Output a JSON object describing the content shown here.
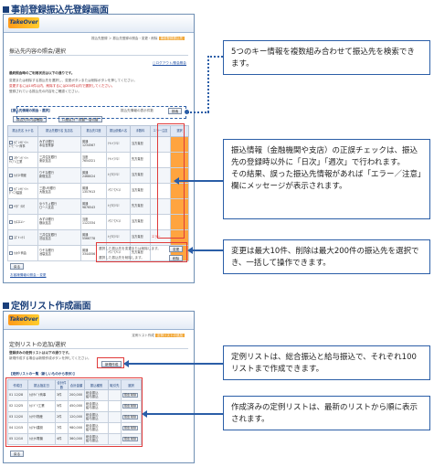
{
  "sections": {
    "registration_title": "事前登録振込先登録画面",
    "template_title": "定例リスト作成画面"
  },
  "reg_screen": {
    "logo": "TakeOver",
    "breadcrumb": "振込先登録 ＞ 振込先登録の照会・変更・削除",
    "breadcrumb_highlight": "事前登録振込先",
    "page_title": "振込先内容の照会/選択",
    "link_top": "□ログアウト/照会照会",
    "notice_heading": "最終照会時のご利用状況は以下の通りです。",
    "notice_lines": [
      "変更または削除する振込先を選択し、変更ボタンまたは削除ボタンを押してください。",
      "変更するには10件以内、削除するには200件以内で選択してください。",
      "登録されている振込先の内容をご確認ください。"
    ],
    "search_label": "【振込先情報の照会・選択】",
    "search_right": "振込先情報の表示件数",
    "search_button": "検索",
    "filter_btn_1": "振込先の内容確認",
    "filter_btn_2": "口座区分・振替一括切替",
    "table_headers": [
      "振込先名 カナ名",
      "振込先銀行名 支店名",
      "振込先口座",
      "振込依頼人名",
      "手数料",
      "エラー注意",
      "選択"
    ],
    "rows": [
      {
        "name": "ｶﾌﾞｼｷｶﾞｲｼｬ\nｴｰﾋﾞｰｼｰ商事",
        "bank": "みずほ銀行\n本店営業部",
        "acct": "普通\n1234567",
        "req": "ﾃｲﾚｲﾌﾘｺﾐ",
        "fee": "当方負担",
        "err": "",
        "sel": ""
      },
      {
        "name": "ﾕｳｹﾞﾝｶﾞｲｼｬ\nｻﾝﾌﾟﾙ工業",
        "bank": "三井住友銀行\n東京支店",
        "acct": "当座\n7654321",
        "req": "ﾃｲﾚｲﾌﾘｺﾐ",
        "fee": "先方負担",
        "err": "",
        "sel": ""
      },
      {
        "name": "ｶ)ﾃｽﾄ物産",
        "bank": "りそな銀行\n新宿支店",
        "acct": "普通\n2468024",
        "req": "ｷｭｳﾖﾌﾘｺﾐ",
        "fee": "当方負担",
        "err": "",
        "sel": ""
      },
      {
        "name": "ｶﾌﾞｼｷｶﾞｲｼｬ\nﾀﾞｲﾆﾁ建設",
        "bank": "三菱UFJ銀行\n大阪支店",
        "acct": "普通\n1357913",
        "req": "ｿｳｺﾞｳﾌﾘｺﾐ",
        "fee": "当方負担",
        "err": "",
        "sel": ""
      },
      {
        "name": "ﾔﾏﾀﾞ ﾀﾛｳ",
        "bank": "ゆうちょ銀行\n〇一八支店",
        "acct": "普通\n9876543",
        "req": "ｷｭｳﾖﾌﾘｺﾐ",
        "fee": "先方負担",
        "err": "",
        "sel": ""
      },
      {
        "name": "ｶ)ｴｽｴﾑｼｰ",
        "bank": "みずほ銀行\n横浜支店",
        "acct": "当座\n1122334",
        "req": "ｿｳｺﾞｳﾌﾘｺﾐ",
        "fee": "当方負担",
        "err": "",
        "sel": ""
      },
      {
        "name": "ｽｽﾞｷ ﾊﾅｺ",
        "bank": "三井住友銀行\n渋谷支店",
        "acct": "普通\n5566778",
        "req": "ｷｭｳﾖﾌﾘｺﾐ",
        "fee": "当方負担",
        "err": "エラー",
        "sel": ""
      },
      {
        "name": "ｶ)ﾎｸﾄ商会",
        "bank": "りそな銀行\n池袋支店",
        "acct": "普通\n3344556",
        "req": "ｿｳｺﾞｳﾌﾘｺﾐ",
        "fee": "先方負担",
        "err": "",
        "sel": ""
      }
    ],
    "action_text_1": "選択した振込先を変更または削除します。",
    "action_text_2": "選択した振込先を削除します。",
    "change_button": "変更",
    "delete_button": "削除",
    "back_button": "戻る",
    "footer_link": "お客様情報の照会・変更"
  },
  "tmpl_screen": {
    "logo": "TakeOver",
    "breadcrumb": "定例リスト作成",
    "breadcrumb_highlight": "定例リストの追加",
    "page_title": "定例リストの追加/選択",
    "notice_heading": "登録済みの定例リストは以下の通りです。",
    "notice_line": "新規作成する場合は新規作成ボタンを押してください。",
    "new_button": "新規作成",
    "table_label": "【定例リストの一覧（新しいものから表示）】",
    "headers": [
      "作成日",
      "振込指定日",
      "合計件数",
      "合計金額",
      "振込種別",
      "取引先",
      "選択"
    ],
    "rows": [
      {
        "no": "01",
        "date": "12/28",
        "name": "ｶ)ﾀﾁﾊﾞﾅ商事",
        "cnt": "3件",
        "amt": "200,000",
        "type": "総合振込\n給与振込",
        "btn": "照会 削除"
      },
      {
        "no": "02",
        "date": "12/25",
        "name": "ｶ)ﾐﾄﾞﾘ工業",
        "cnt": "5件",
        "amt": "450,000",
        "type": "総合振込\n給与振込",
        "btn": "照会 削除"
      },
      {
        "no": "03",
        "date": "12/20",
        "name": "ｶ)ｻｸﾗ物産",
        "cnt": "2件",
        "amt": "120,000",
        "type": "総合振込\n給与振込",
        "btn": "照会 削除"
      },
      {
        "no": "04",
        "date": "12/15",
        "name": "ｶ)ｱｵｲ建設",
        "cnt": "7件",
        "amt": "980,000",
        "type": "総合振込\n給与振込",
        "btn": "照会 削除"
      },
      {
        "no": "05",
        "date": "12/10",
        "name": "ｶ)ﾋｶﾘ電機",
        "cnt": "4件",
        "amt": "360,000",
        "type": "総合振込\n給与振込",
        "btn": "照会 削除"
      }
    ],
    "back_button": "戻る"
  },
  "callouts": {
    "c1": "5つのキー情報を複数組み合わせて振込先を検索できます。",
    "c2": "振込情報（金融機関や支店）の正誤チェックは、振込先の登録時以外に「日次」「週次」で行われます。\nその結果、誤った振込先情報があれば「エラー／注意」欄にメッセージが表示されます。",
    "c3": "変更は最大10件、削除は最大200件の振込先を選択でき、一括して操作できます。",
    "c4": "定例リストは、総合振込と給与振込で、それぞれ100リストまで作成できます。",
    "c5": "作成済みの定例リストは、最新のリストから順に表示されます。"
  },
  "colors": {
    "accent": "#1a3f7a",
    "callout_border": "#2b5ea7",
    "highlight_orange": "#ffa43f",
    "error_red": "#e03a3a"
  }
}
